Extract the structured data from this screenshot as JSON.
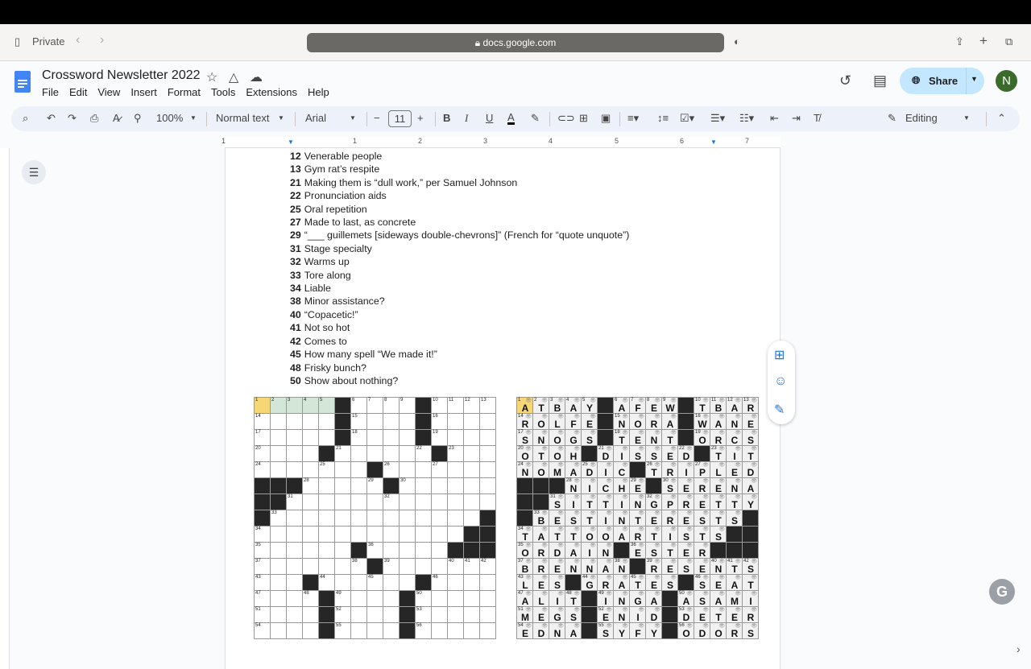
{
  "browser": {
    "private_label": "Private",
    "url": "docs.google.com"
  },
  "doc": {
    "title": "Crossword Newsletter 2022",
    "menu": [
      "File",
      "Edit",
      "View",
      "Insert",
      "Format",
      "Tools",
      "Extensions",
      "Help"
    ],
    "share_label": "Share",
    "avatar_initial": "N"
  },
  "toolbar": {
    "zoom": "100%",
    "style": "Normal text",
    "font": "Arial",
    "font_size": "11",
    "mode": "Editing"
  },
  "ruler": {
    "ticks": [
      "1",
      "1",
      "2",
      "3",
      "4",
      "5",
      "6",
      "7"
    ]
  },
  "clues": [
    {
      "num": "12",
      "text": "Venerable people"
    },
    {
      "num": "13",
      "text": "Gym rat’s respite"
    },
    {
      "num": "21",
      "text": "Making them is “dull work,” per Samuel Johnson"
    },
    {
      "num": "22",
      "text": "Pronunciation aids"
    },
    {
      "num": "25",
      "text": "Oral repetition"
    },
    {
      "num": "27",
      "text": "Made to last, as concrete"
    },
    {
      "num": "29",
      "text": "“___ guillemets [sideways double-chevrons]” (French for “quote unquote”)"
    },
    {
      "num": "31",
      "text": "Stage specialty"
    },
    {
      "num": "32",
      "text": "Warms up"
    },
    {
      "num": "33",
      "text": "Tore along"
    },
    {
      "num": "34",
      "text": "Liable"
    },
    {
      "num": "38",
      "text": "Minor assistance?"
    },
    {
      "num": "40",
      "text": "“Copacetic!”"
    },
    {
      "num": "41",
      "text": "Not so hot"
    },
    {
      "num": "42",
      "text": "Comes to"
    },
    {
      "num": "45",
      "text": "How many spell “We made it!”"
    },
    {
      "num": "48",
      "text": "Frisky bunch?"
    },
    {
      "num": "50",
      "text": "Show about nothing?"
    }
  ],
  "crossword": {
    "solution": [
      "ATBAY#AFEW#TBAR",
      "ROLFE#NORA#WANE",
      "SNOGS#TENT#ORCS",
      "OTOH#DISSED#TIT",
      "NOMADIC#TRIPLED",
      "###NICHE#SERENA",
      "##SITTINGPRETTY",
      "#BESTINTERESTS#",
      "TATTOOARTISTS##",
      "ORDAIN#ESTER###",
      "BRENNAN#RESENTS",
      "LES#GRATES#SEAT",
      "ALIT#INGA#ASAMI",
      "MEGS#ENID#DETER",
      "EDNA#SYFY#ODORS"
    ],
    "selected_cell": "1",
    "highlight_color": "#f7d675",
    "word_highlight_color": "#d3e6d8"
  }
}
